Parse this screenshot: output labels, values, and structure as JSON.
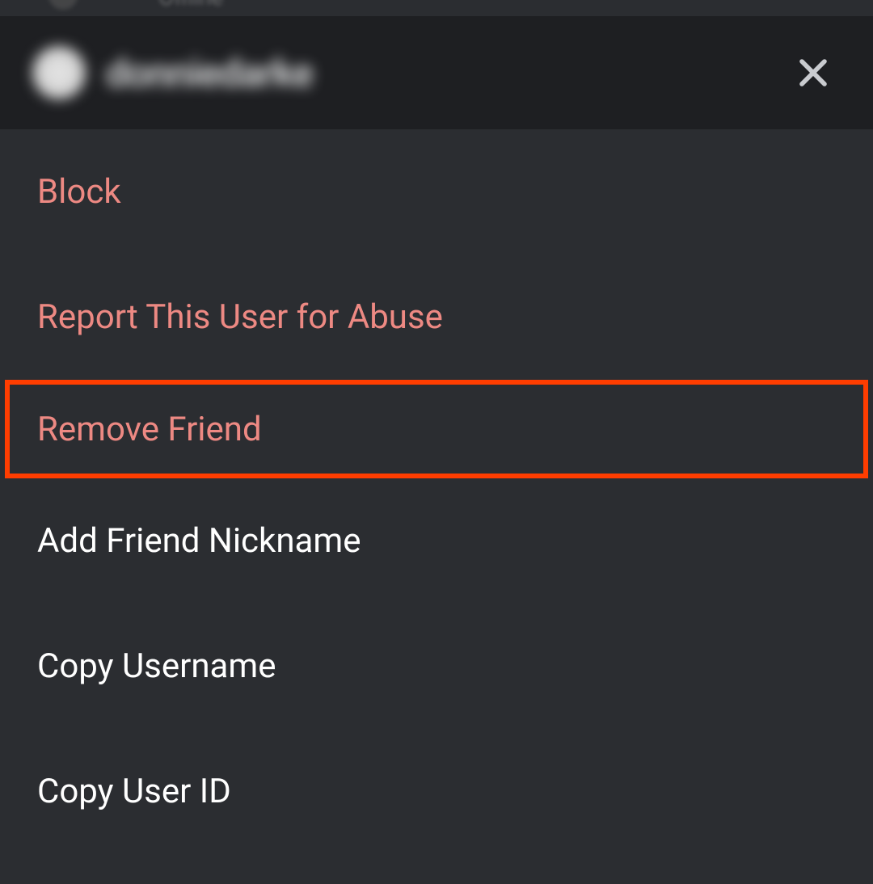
{
  "topStrip": {
    "status": "Offline"
  },
  "header": {
    "username": "donniedarke"
  },
  "colors": {
    "danger": "#ed8983",
    "normal": "#ffffff",
    "headerBg": "#1e1f22",
    "menuBg": "#2b2d31",
    "highlightBorder": "#ff3d00"
  },
  "menu": {
    "items": [
      {
        "label": "Block",
        "type": "danger",
        "highlighted": false
      },
      {
        "label": "Report This User for Abuse",
        "type": "danger",
        "highlighted": false
      },
      {
        "label": "Remove Friend",
        "type": "danger",
        "highlighted": true
      },
      {
        "label": "Add Friend Nickname",
        "type": "normal",
        "highlighted": false
      },
      {
        "label": "Copy Username",
        "type": "normal",
        "highlighted": false
      },
      {
        "label": "Copy User ID",
        "type": "normal",
        "highlighted": false
      }
    ]
  }
}
